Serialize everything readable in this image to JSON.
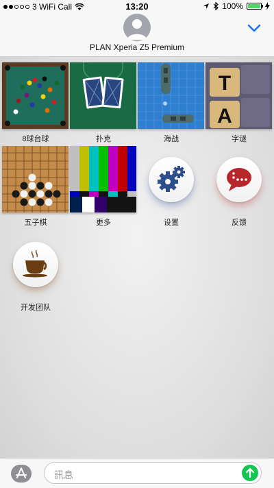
{
  "status_bar": {
    "carrier": "3 WiFi Call",
    "time": "13:20",
    "battery_percent": "100%",
    "signal_bars_filled": 2,
    "signal_bars_total": 5,
    "battery_level": 1.0,
    "battery_color": "#4cd964"
  },
  "header": {
    "contact_name": "PLAN Xperia Z5 Premium",
    "chevron_color": "#1a73e8"
  },
  "apps": [
    {
      "label": "8球台球",
      "icon": "billiards-thumbnail"
    },
    {
      "label": "扑克",
      "icon": "playing-cards-thumbnail"
    },
    {
      "label": "海战",
      "icon": "battleship-thumbnail"
    },
    {
      "label": "字谜",
      "icon": "letter-tiles-thumbnail"
    },
    {
      "label": "五子棋",
      "icon": "gomoku-board-thumbnail"
    },
    {
      "label": "更多",
      "icon": "color-bars-thumbnail"
    },
    {
      "label": "设置",
      "icon": "gears-icon"
    },
    {
      "label": "反馈",
      "icon": "speech-bubble-icon"
    },
    {
      "label": "开发团队",
      "icon": "coffee-cup-icon"
    }
  ],
  "input_bar": {
    "placeholder": "訊息",
    "send_color": "#13c552"
  }
}
